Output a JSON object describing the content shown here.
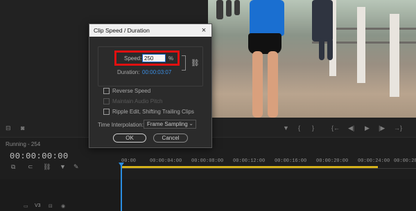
{
  "dialog": {
    "title": "Clip Speed / Duration",
    "close_icon": "×",
    "speed_label": "Speed:",
    "speed_value": "250",
    "speed_unit": "%",
    "duration_label": "Duration:",
    "duration_value": "00:00:03:07",
    "link_icon": "chain-link-icon",
    "reverse_speed": "Reverse Speed",
    "maintain_pitch": "Maintain Audio Pitch",
    "ripple_edit": "Ripple Edit, Shifting Trailing Clips",
    "interp_label": "Time Interpolation:",
    "interp_value": "Frame Sampling",
    "ok": "OK",
    "cancel": "Cancel"
  },
  "timeline": {
    "sequence_tab": "Running - 254",
    "timecode": "00:00:00:00",
    "ruler": [
      "00:00",
      "00:00:04:00",
      "00:00:08:00",
      "00:00:12:00",
      "00:00:16:00",
      "00:00:20:00",
      "00:00:24:00",
      "00:00:28"
    ],
    "track_label": "V3"
  },
  "colors": {
    "accent_blue": "#2a8de0",
    "work_area": "#d6b21a",
    "highlight": "#e01010"
  }
}
